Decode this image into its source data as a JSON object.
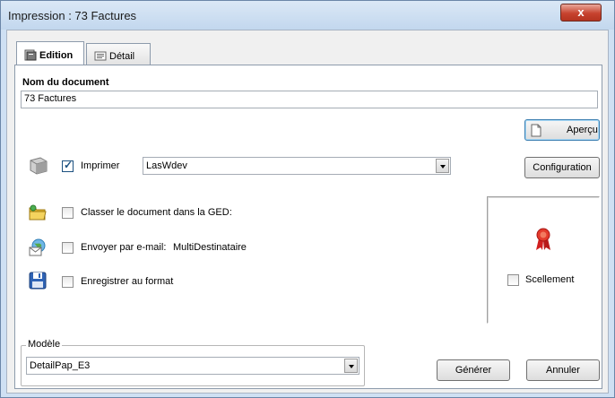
{
  "window": {
    "title": "Impression : 73 Factures",
    "close_glyph": "x"
  },
  "tabs": [
    {
      "label": "Edition",
      "icon": "edition-icon",
      "active": true
    },
    {
      "label": "Détail",
      "icon": "detail-icon",
      "active": false
    }
  ],
  "document": {
    "section_label": "Nom du document",
    "name_value": "73 Factures"
  },
  "preview": {
    "label": "Aperçu",
    "icon": "preview-icon"
  },
  "print": {
    "icon": "printer-icon",
    "checkbox_label": "Imprimer",
    "checked": true,
    "printer_value": "LasWdev",
    "config_label": "Configuration"
  },
  "options": {
    "ged": {
      "label": "Classer le document dans la GED:",
      "icon": "folder-icon",
      "checked": false
    },
    "email": {
      "label": "Envoyer par e-mail:",
      "recipient": "MultiDestinataire",
      "icon": "email-icon",
      "checked": false
    },
    "save": {
      "label": "Enregistrer au format",
      "icon": "floppy-disk-icon",
      "checked": false
    }
  },
  "seal": {
    "label": "Scellement",
    "icon": "seal-ribbon-icon",
    "checked": false
  },
  "model": {
    "legend": "Modèle",
    "value": "DetailPap_E3"
  },
  "buttons": {
    "generate_label": "Générer",
    "cancel_label": "Annuler"
  },
  "colors": {
    "titlebar": "#c2d7ee",
    "close_button": "#c7432f",
    "check_mark": "#1c5180",
    "seal_red": "#d11f1f"
  }
}
